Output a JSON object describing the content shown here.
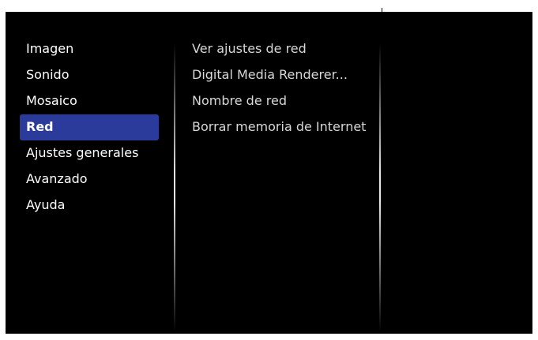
{
  "main_menu": {
    "items": [
      {
        "label": "Imagen"
      },
      {
        "label": "Sonido"
      },
      {
        "label": "Mosaico"
      },
      {
        "label": "Red"
      },
      {
        "label": "Ajustes generales"
      },
      {
        "label": "Avanzado"
      },
      {
        "label": "Ayuda"
      }
    ],
    "selected": "Red"
  },
  "submenu": {
    "items": [
      {
        "label": "Ver ajustes de red"
      },
      {
        "label": "Digital Media Renderer..."
      },
      {
        "label": "Nombre de red"
      },
      {
        "label": "Borrar memoria de Internet"
      }
    ]
  },
  "colors": {
    "background": "#000000",
    "selection": "#2b3b9c",
    "text": "#ffffff",
    "submenu_text": "#d8d8d8"
  }
}
